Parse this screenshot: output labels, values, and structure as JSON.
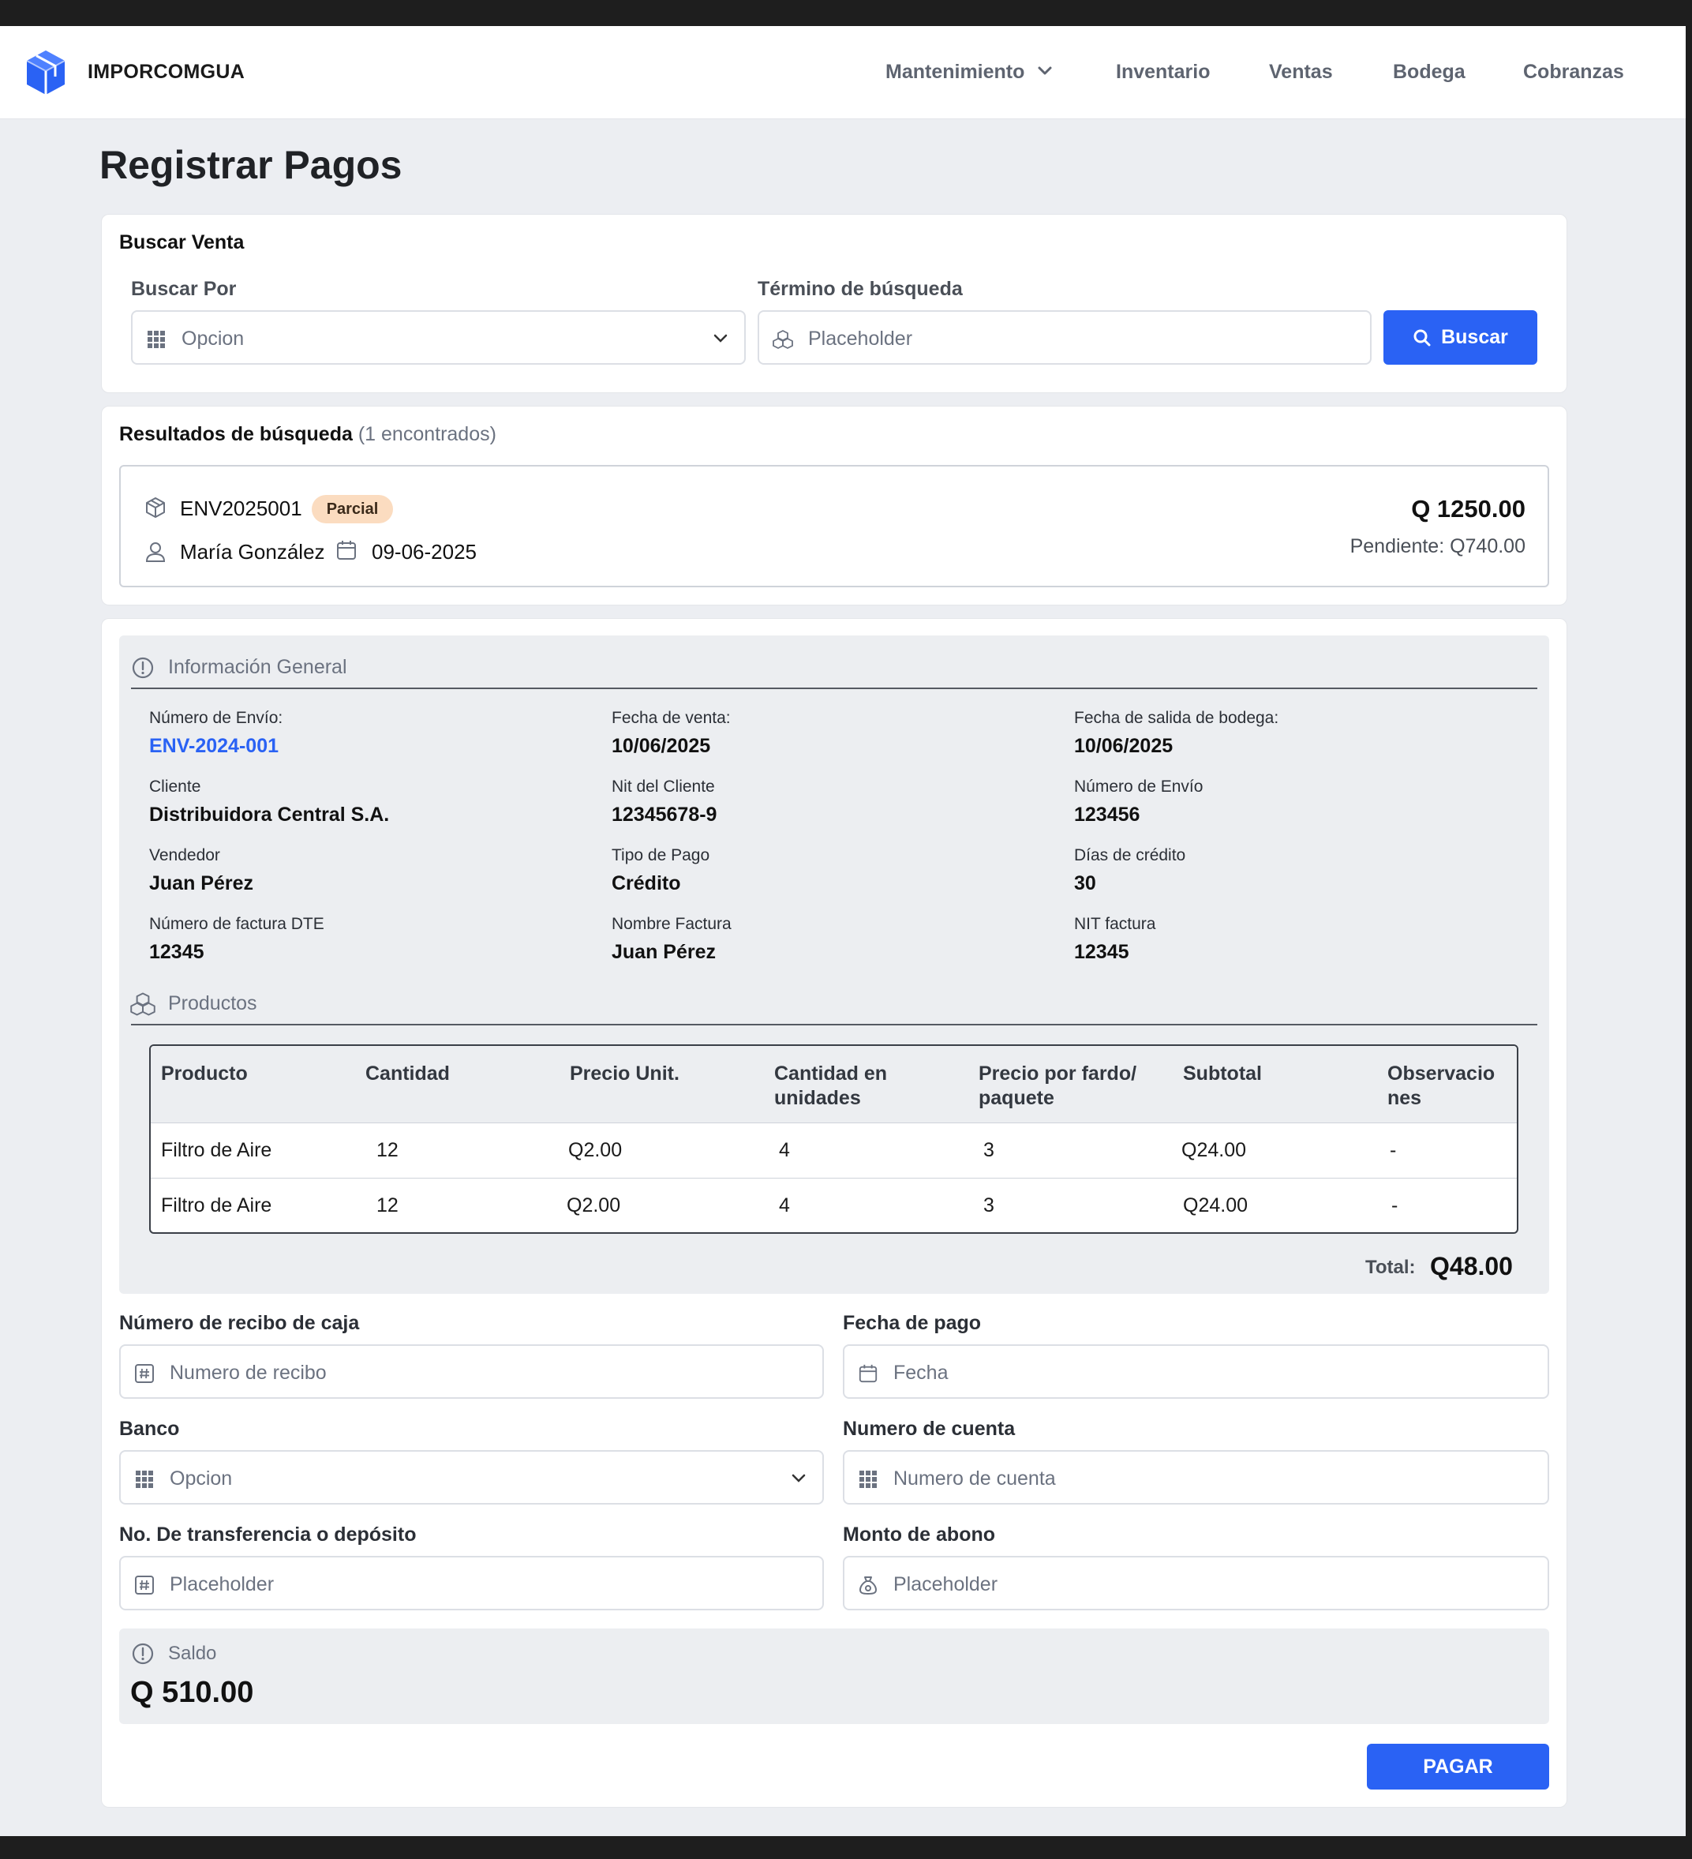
{
  "brand": "IMPORCOMGUA",
  "nav": {
    "mantenimiento": "Mantenimiento",
    "inventario": "Inventario",
    "ventas": "Ventas",
    "bodega": "Bodega",
    "cobranzas": "Cobranzas"
  },
  "page_title": "Registrar Pagos",
  "search": {
    "title": "Buscar Venta",
    "by_label": "Buscar Por",
    "by_value": "Opcion",
    "term_label": "Término de búsqueda",
    "term_placeholder": "Placeholder",
    "button": "Buscar"
  },
  "results": {
    "title": "Resultados de búsqueda",
    "count": "(1 encontrados)",
    "item": {
      "code": "ENV2025001",
      "status": "Parcial",
      "client": "María González",
      "date": "09-06-2025",
      "amount": "Q 1250.00",
      "pending": "Pendiente: Q740.00"
    }
  },
  "general_info": {
    "title": "Información General",
    "fields": [
      {
        "label": "Número de Envío:",
        "value": "ENV-2024-001"
      },
      {
        "label": "Fecha de venta:",
        "value": "10/06/2025"
      },
      {
        "label": "Fecha de salida de bodega:",
        "value": "10/06/2025"
      },
      {
        "label": "Cliente",
        "value": "Distribuidora Central S.A."
      },
      {
        "label": "Nit del Cliente",
        "value": "12345678-9"
      },
      {
        "label": "Número de Envío",
        "value": "123456"
      },
      {
        "label": "Vendedor",
        "value": "Juan Pérez"
      },
      {
        "label": "Tipo de Pago",
        "value": "Crédito"
      },
      {
        "label": "Días de crédito",
        "value": "30"
      },
      {
        "label": "Número de factura DTE",
        "value": "12345"
      },
      {
        "label": "Nombre Factura",
        "value": "Juan Pérez"
      },
      {
        "label": "NIT factura",
        "value": "12345"
      }
    ]
  },
  "products": {
    "title": "Productos",
    "columns": [
      "Producto",
      "Cantidad",
      "Precio Unit.",
      "Cantidad en unidades",
      "Precio por fardo/ paquete",
      "Subtotal",
      "Observaciones"
    ],
    "rows": [
      [
        "Filtro de Aire",
        "12",
        "Q2.00",
        "4",
        "3",
        "Q24.00",
        "-"
      ],
      [
        "Filtro de Aire",
        "12",
        "Q2.00",
        "4",
        "3",
        "Q24.00",
        "-"
      ]
    ],
    "total_label": "Total:",
    "total_value": "Q48.00"
  },
  "payment": {
    "receipt_label": "Número de recibo de caja",
    "receipt_placeholder": "Numero de recibo",
    "date_label": "Fecha de pago",
    "date_placeholder": "Fecha",
    "bank_label": "Banco",
    "bank_value": "Opcion",
    "account_label": "Numero de cuenta",
    "account_placeholder": "Numero de cuenta",
    "transfer_label": "No. De transferencia o depósito",
    "transfer_placeholder": "Placeholder",
    "amount_label": "Monto de abono",
    "amount_placeholder": "Placeholder"
  },
  "saldo": {
    "label": "Saldo",
    "value": "Q 510.00"
  },
  "pay_button": "PAGAR",
  "colors": {
    "accent": "#2a62f4",
    "badge_bg": "#fbdcc0",
    "page_bg": "#eceef2"
  }
}
